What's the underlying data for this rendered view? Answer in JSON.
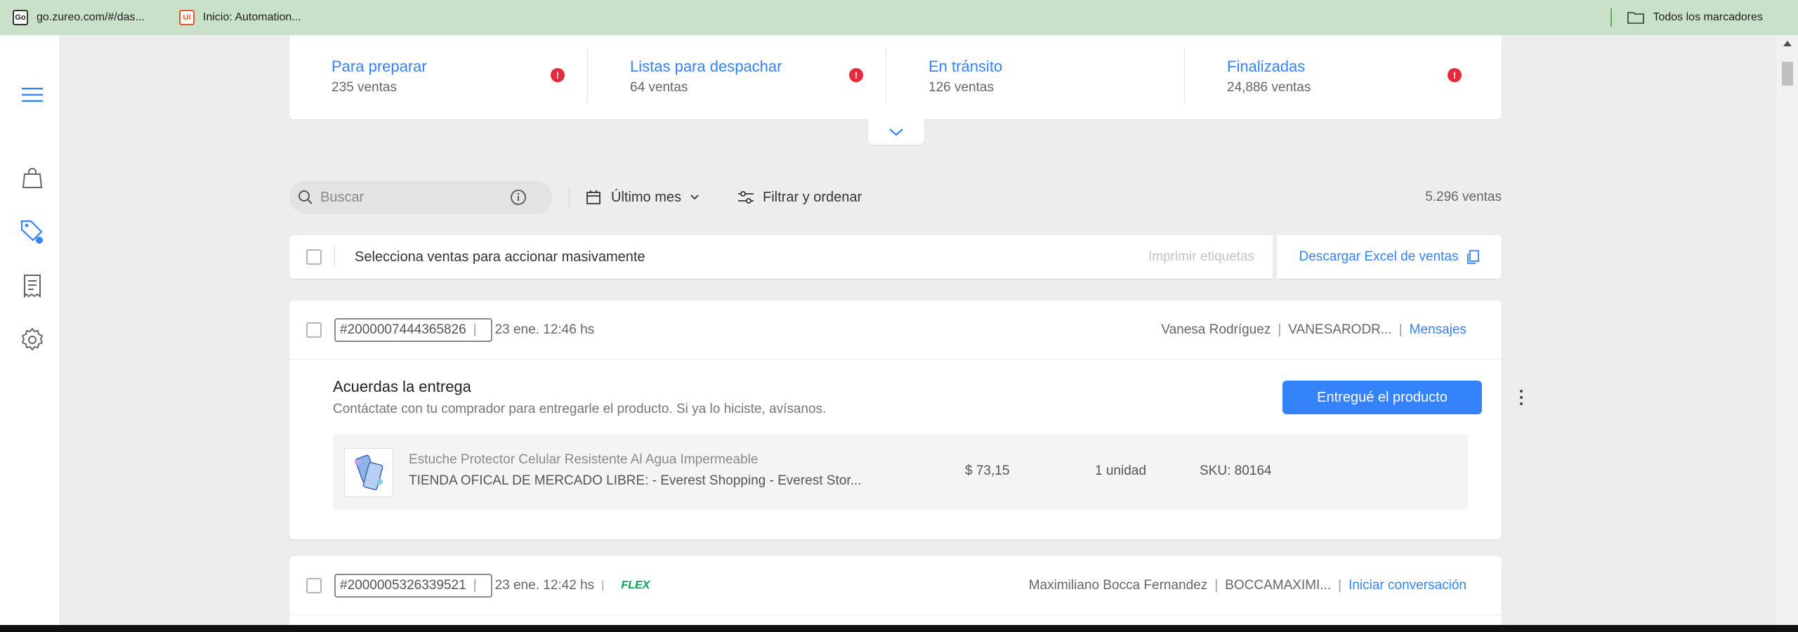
{
  "bookmarks": {
    "items": [
      {
        "label": "go.zureo.com/#/das...",
        "icon": "Go"
      },
      {
        "label": "Inicio: Automation...",
        "icon": "Ui"
      }
    ],
    "all_bookmarks_label": "Todos los marcadores"
  },
  "nav": {
    "items": [
      "menu-icon",
      "shopping-bag-icon",
      "sales-tag-icon",
      "receipt-icon",
      "settings-icon"
    ],
    "accent": "#3483fa"
  },
  "status": {
    "items": [
      {
        "title": "Para preparar",
        "count": "235 ventas",
        "alert": "!"
      },
      {
        "title": "Listas para despachar",
        "count": "64 ventas",
        "alert": "!"
      },
      {
        "title": "En tránsito",
        "count": "126 ventas"
      },
      {
        "title": "Finalizadas",
        "count": "24,886 ventas",
        "alert": "!"
      }
    ]
  },
  "toolbar": {
    "search_placeholder": "Buscar",
    "period_label": "Último mes",
    "filter_label": "Filtrar y ordenar",
    "total": "5.296 ventas"
  },
  "bulk": {
    "label": "Selecciona ventas para accionar masivamente",
    "print_labels": "Imprimir etiquetas",
    "excel": "Descargar Excel de ventas"
  },
  "orders": [
    {
      "id": "#2000007444365826",
      "date": "23 ene. 12:46 hs",
      "buyer_name": "Vanesa Rodríguez",
      "buyer_nick": "VANESARODR...",
      "action_link": "Mensajes",
      "section_title": "Acuerdas la entrega",
      "section_sub": "Contáctate con tu comprador para entregarle el producto. Si ya lo hiciste, avísanos.",
      "primary_action": "Entregué el producto",
      "product": {
        "title": "Estuche Protector Celular Resistente Al Agua Impermeable",
        "store": "TIENDA OFICAL DE MERCADO LIBRE: - Everest Shopping - Everest Stor...",
        "price": "$ 73,15",
        "qty": "1 unidad",
        "sku": "SKU: 80164"
      }
    },
    {
      "id": "#2000005326339521",
      "date": "23 ene. 12:42 hs",
      "badge": "FLEX",
      "buyer_name": "Maximiliano Bocca Fernandez",
      "buyer_nick": "BOCCAMAXIMI...",
      "action_link": "Iniciar conversación"
    }
  ]
}
